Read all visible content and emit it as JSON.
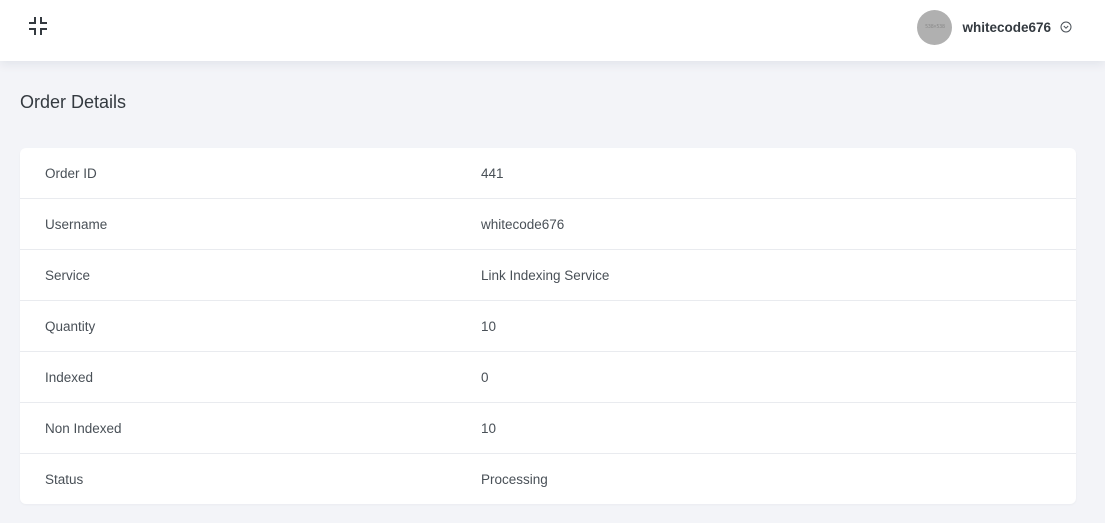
{
  "header": {
    "collapse_icon": "collapse-icon",
    "avatar_text": "538×538",
    "username": "whitecode676",
    "dropdown_icon": "chevron-down-icon"
  },
  "page": {
    "title": "Order Details"
  },
  "order_details": [
    {
      "label": "Order ID",
      "value": "441"
    },
    {
      "label": "Username",
      "value": "whitecode676"
    },
    {
      "label": "Service",
      "value": "Link Indexing Service"
    },
    {
      "label": "Quantity",
      "value": "10"
    },
    {
      "label": "Indexed",
      "value": "0"
    },
    {
      "label": "Non Indexed",
      "value": "10"
    },
    {
      "label": "Status",
      "value": "Processing"
    }
  ],
  "colors": {
    "background": "#f3f4f8",
    "card": "#ffffff",
    "text": "#495057",
    "heading": "#343a40"
  }
}
